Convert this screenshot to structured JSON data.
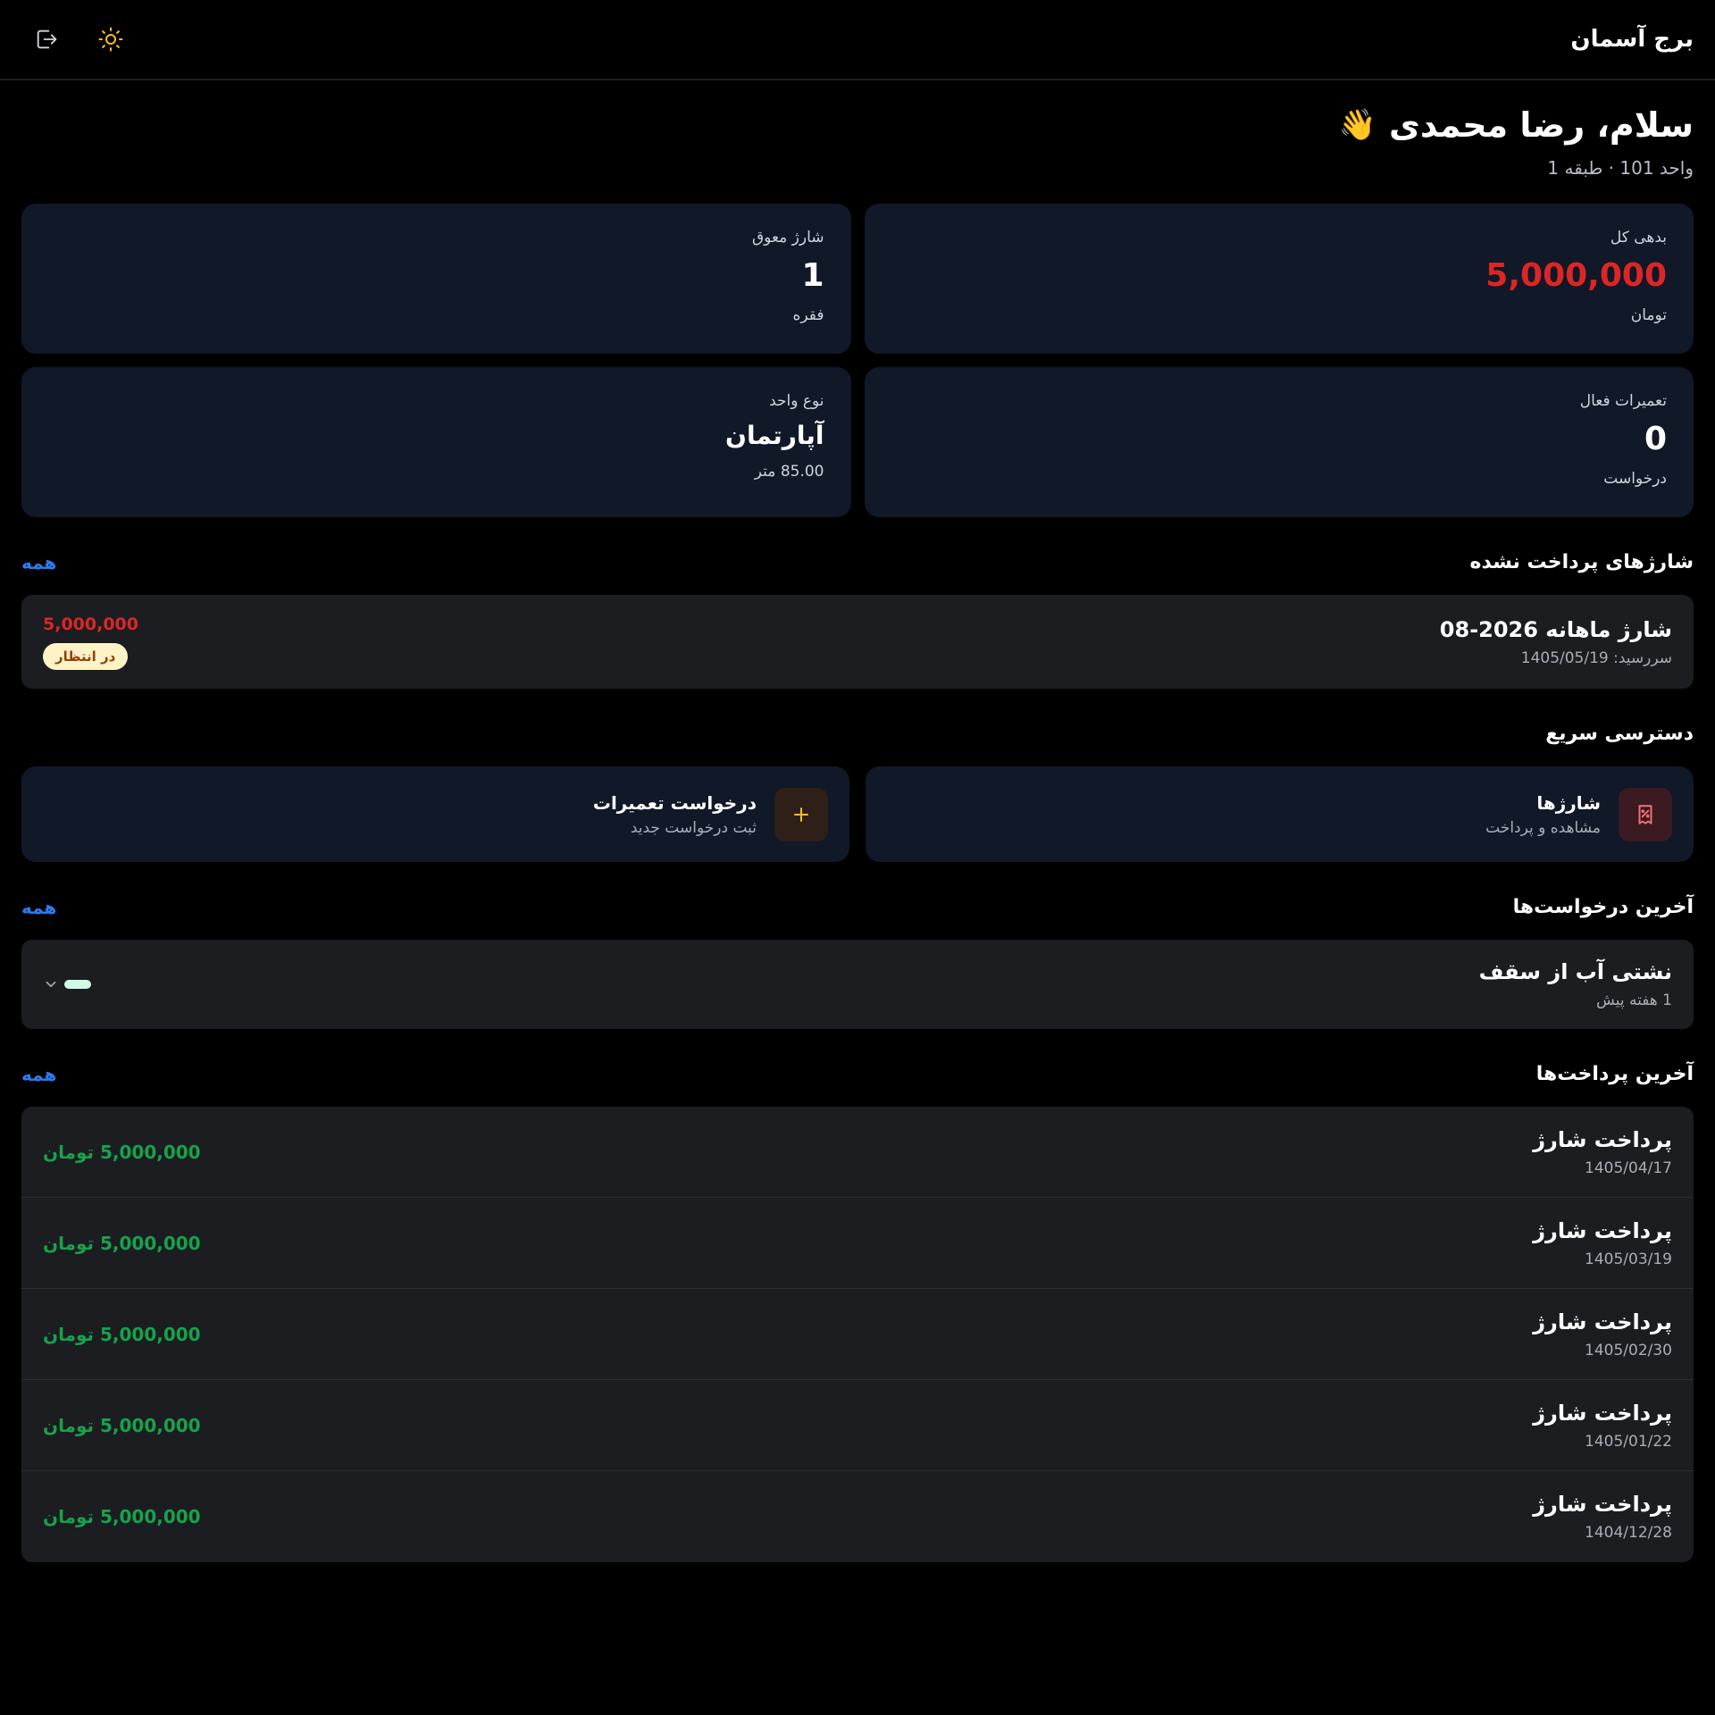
{
  "header": {
    "brand": "برج آسمان"
  },
  "greeting": {
    "text": "سلام، رضا محمدی",
    "emoji": "👋",
    "unit_line": "واحد 101 · طبقه 1"
  },
  "stats": [
    {
      "label": "بدهی کل",
      "value": "5,000,000",
      "sub": "تومان"
    },
    {
      "label": "شارژ معوق",
      "value": "1",
      "sub": "فقره"
    },
    {
      "label": "تعمیرات فعال",
      "value": "0",
      "sub": "درخواست"
    },
    {
      "label": "نوع واحد",
      "value": "آپارتمان",
      "sub": "85.00 متر"
    }
  ],
  "unpaid": {
    "title": "شارژهای پرداخت نشده",
    "see_all": "همه",
    "item": {
      "title": "شارژ ماهانه 2026-08",
      "due": "سررسید: 1405/05/19",
      "amount": "5,000,000",
      "status": "در انتظار"
    }
  },
  "quick": {
    "title": "دسترسی سریع",
    "items": [
      {
        "title": "شارژها",
        "sub": "مشاهده و پرداخت",
        "icon": "receipt-icon"
      },
      {
        "title": "درخواست تعمیرات",
        "sub": "ثبت درخواست جدید",
        "icon": "plus-icon"
      }
    ]
  },
  "requests": {
    "title": "آخرین درخواست‌ها",
    "see_all": "همه",
    "item": {
      "title": "نشتی آب از سقف",
      "time": "1 هفته پیش"
    }
  },
  "payments": {
    "title": "آخرین پرداخت‌ها",
    "see_all": "همه",
    "items": [
      {
        "title": "پرداخت شارژ",
        "date": "1405/04/17",
        "amount": "5,000,000 تومان"
      },
      {
        "title": "پرداخت شارژ",
        "date": "1405/03/19",
        "amount": "5,000,000 تومان"
      },
      {
        "title": "پرداخت شارژ",
        "date": "1405/02/30",
        "amount": "5,000,000 تومان"
      },
      {
        "title": "پرداخت شارژ",
        "date": "1405/01/22",
        "amount": "5,000,000 تومان"
      },
      {
        "title": "پرداخت شارژ",
        "date": "1404/12/28",
        "amount": "5,000,000 تومان"
      }
    ]
  },
  "colors": {
    "accent": "#2b7bf0",
    "danger": "#dc2626",
    "success": "#16a34a",
    "card": "#111827",
    "dark_card": "#1c1d21"
  }
}
